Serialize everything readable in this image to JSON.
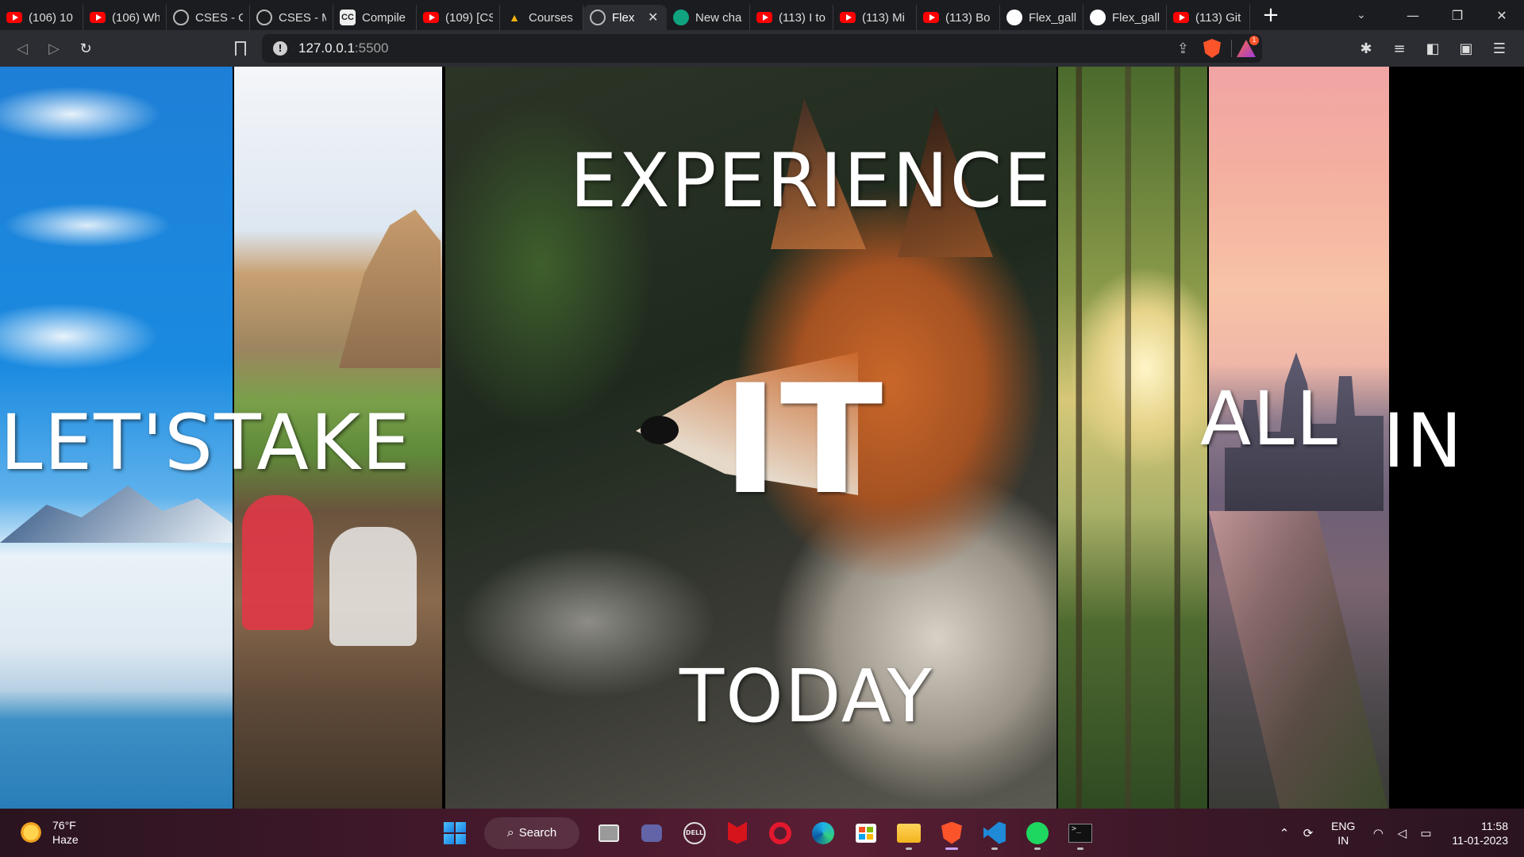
{
  "browser": {
    "tabs": [
      {
        "title": "(106) 10",
        "favicon": "youtube-icon"
      },
      {
        "title": "(106) Wh",
        "favicon": "youtube-icon"
      },
      {
        "title": "CSES - C",
        "favicon": "globe-icon"
      },
      {
        "title": "CSES - M",
        "favicon": "globe-icon"
      },
      {
        "title": "Compile",
        "favicon": "cc-icon"
      },
      {
        "title": "(109) [CS",
        "favicon": "youtube-icon"
      },
      {
        "title": "Courses",
        "favicon": "courses-icon"
      },
      {
        "title": "Flex",
        "favicon": "globe-icon",
        "active": true
      },
      {
        "title": "New cha",
        "favicon": "chatgpt-icon"
      },
      {
        "title": "(113) I to",
        "favicon": "youtube-icon"
      },
      {
        "title": "(113) Mi",
        "favicon": "youtube-icon"
      },
      {
        "title": "(113) Bo",
        "favicon": "youtube-icon"
      },
      {
        "title": "Flex_gall",
        "favicon": "github-icon"
      },
      {
        "title": "Flex_gall",
        "favicon": "github-icon"
      },
      {
        "title": "(113) Git",
        "favicon": "youtube-icon"
      }
    ],
    "new_tab": "+",
    "url_host": "127.0.0.1",
    "url_port": ":5500",
    "rewards_badge": "1"
  },
  "gallery": {
    "word_lets": "LET'S",
    "word_take": "TAKE",
    "word_experience": "EXPERIENCE",
    "word_it": "IT",
    "word_today": "TODAY",
    "word_all": "ALL",
    "word_in": "IN",
    "panels": [
      "sky-snow",
      "yosemite-friends",
      "red-fox",
      "sunlit-forest",
      "city-highway"
    ]
  },
  "taskbar": {
    "weather_temp": "76°F",
    "weather_desc": "Haze",
    "search_label": "Search",
    "lang_line1": "ENG",
    "lang_line2": "IN",
    "time": "11:58",
    "date": "11-01-2023"
  },
  "colors": {
    "tabstrip": "#1b1c20",
    "toolbar": "#2b2d33",
    "accent_brave": "#fb542b"
  }
}
